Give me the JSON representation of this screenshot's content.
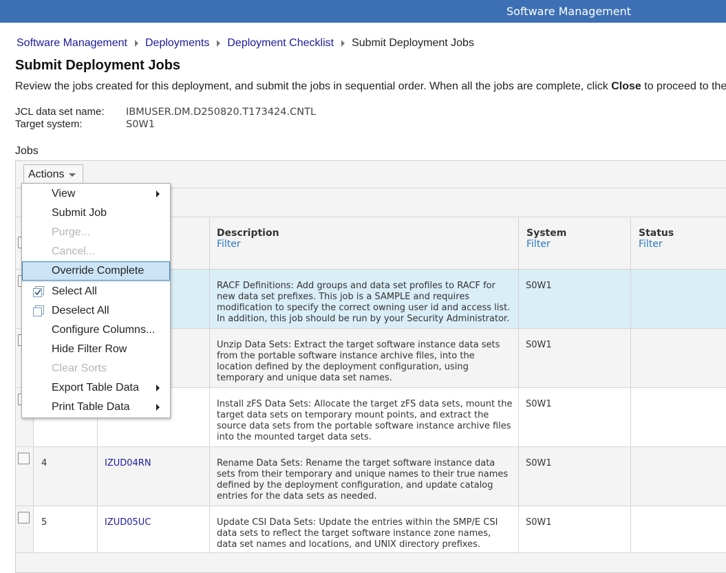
{
  "header": {
    "app_title": "Software Management"
  },
  "breadcrumb": {
    "items": [
      "Software Management",
      "Deployments",
      "Deployment Checklist"
    ],
    "current": "Submit Deployment Jobs"
  },
  "page": {
    "title": "Submit Deployment Jobs",
    "instructions_before": "Review the jobs created for this deployment, and submit the jobs in sequential order. When all the jobs are complete, click ",
    "instructions_bold": "Close",
    "instructions_after": " to proceed to the next"
  },
  "info": {
    "jcl_label": "JCL data set name:",
    "jcl_value": "IBMUSER.DM.D250820.T173424.CNTL",
    "target_label": "Target system:",
    "target_value": "S0W1"
  },
  "jobs": {
    "label": "Jobs",
    "actions_label": "Actions",
    "columns": {
      "description": "Description",
      "system": "System",
      "status": "Status",
      "filter": "Filter"
    },
    "rows": [
      {
        "num": "",
        "name": "",
        "description": "RACF Definitions: Add groups and data set profiles to RACF for new data set prefixes. This job is a SAMPLE and requires modification to specify the correct owning user id and access list. In addition, this job should be run by your Security Administrator.",
        "system": "S0W1"
      },
      {
        "num": "",
        "name": "",
        "description": "Unzip Data Sets: Extract the target software instance data sets from the portable software instance archive files, into the location defined by the deployment configuration, using temporary and unique data set names.",
        "system": "S0W1"
      },
      {
        "num": "",
        "name": "",
        "description": "Install zFS Data Sets: Allocate the target zFS data sets, mount the target data sets on temporary mount points, and extract the source data sets from the portable software instance archive files into the mounted target data sets.",
        "system": "S0W1"
      },
      {
        "num": "4",
        "name": "IZUD04RN",
        "description": "Rename Data Sets: Rename the target software instance data sets from their temporary and unique names to their true names defined by the deployment configuration, and update catalog entries for the data sets as needed.",
        "system": "S0W1"
      },
      {
        "num": "5",
        "name": "IZUD05UC",
        "description": "Update CSI Data Sets: Update the entries within the SMP/E CSI data sets to reflect the target software instance zone names, data set names and locations, and UNIX directory prefixes.",
        "system": "S0W1"
      }
    ]
  },
  "menu": {
    "view": "View",
    "submit_job": "Submit Job",
    "purge": "Purge...",
    "cancel": "Cancel...",
    "override_complete": "Override Complete",
    "select_all": "Select All",
    "deselect_all": "Deselect All",
    "configure_columns": "Configure Columns...",
    "hide_filter_row": "Hide Filter Row",
    "clear_sorts": "Clear Sorts",
    "export_table_data": "Export Table Data",
    "print_table_data": "Print Table Data"
  },
  "colors": {
    "header_bar": "#3d6fb4",
    "link": "#1a1a9c",
    "filter_link": "#2c77bf",
    "selected_row": "#daeef7",
    "menu_highlight": "#cce4f6"
  }
}
